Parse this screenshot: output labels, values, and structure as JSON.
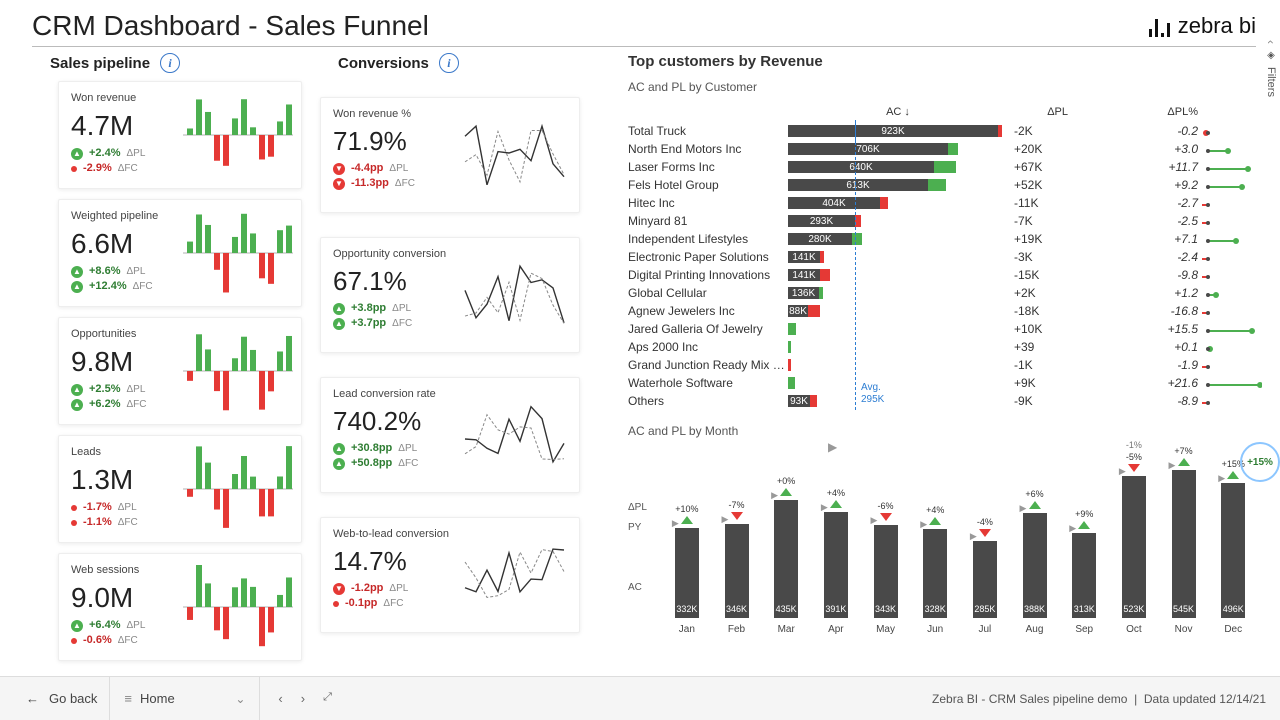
{
  "title": "CRM Dashboard - Sales Funnel",
  "brand": "zebra bi",
  "filters_label": "Filters",
  "sections": {
    "pipeline": "Sales pipeline",
    "conversions": "Conversions",
    "top_customers": "Top customers by Revenue",
    "by_customer_sub": "AC and PL by Customer",
    "by_month_sub": "AC and PL by Month"
  },
  "pipeline_cards": [
    {
      "title": "Won revenue",
      "value": "4.7M",
      "d1": "+2.4%",
      "d1s": "pos",
      "d2": "-2.9%",
      "d2s": "neg",
      "d2icon": "dot"
    },
    {
      "title": "Weighted pipeline",
      "value": "6.6M",
      "d1": "+8.6%",
      "d1s": "pos",
      "d2": "+12.4%",
      "d2s": "pos"
    },
    {
      "title": "Opportunities",
      "value": "9.8M",
      "d1": "+2.5%",
      "d1s": "pos",
      "d2": "+6.2%",
      "d2s": "pos"
    },
    {
      "title": "Leads",
      "value": "1.3M",
      "d1": "-1.7%",
      "d1s": "neg",
      "d1icon": "dot",
      "d2": "-1.1%",
      "d2s": "neg",
      "d2icon": "dot"
    },
    {
      "title": "Web sessions",
      "value": "9.0M",
      "d1": "+6.4%",
      "d1s": "pos",
      "d2": "-0.6%",
      "d2s": "neg",
      "d2icon": "dot"
    }
  ],
  "conversion_cards": [
    {
      "title": "Won revenue %",
      "value": "71.9%",
      "d1": "-4.4pp",
      "d1s": "neg",
      "d2": "-11.3pp",
      "d2s": "neg"
    },
    {
      "title": "Opportunity conversion",
      "value": "67.1%",
      "d1": "+3.8pp",
      "d1s": "pos",
      "d2": "+3.7pp",
      "d2s": "pos"
    },
    {
      "title": "Lead conversion rate",
      "value": "740.2%",
      "d1": "+30.8pp",
      "d1s": "pos",
      "d2": "+50.8pp",
      "d2s": "pos"
    },
    {
      "title": "Web-to-lead conversion",
      "value": "14.7%",
      "d1": "-1.2pp",
      "d1s": "neg",
      "d2": "-0.1pp",
      "d2s": "neg",
      "d2icon": "dot"
    }
  ],
  "delta_labels": {
    "pl": "ΔPL",
    "fc": "ΔFC"
  },
  "table_headers": {
    "ac": "AC ↓",
    "dpl": "ΔPL",
    "dplp": "ΔPL%"
  },
  "avg_label": "Avg.",
  "avg_value": "295K",
  "customers": [
    {
      "name": "Total Truck",
      "ac": "923K",
      "acw": 210,
      "dpl": "-2K",
      "caps": "r",
      "capw": 4,
      "dplp": "-0.2",
      "lolli": -2
    },
    {
      "name": "North End Motors Inc",
      "ac": "706K",
      "acw": 160,
      "dpl": "+20K",
      "caps": "g",
      "capw": 10,
      "dplp": "+3.0",
      "lolli": 20
    },
    {
      "name": "Laser Forms Inc",
      "ac": "640K",
      "acw": 146,
      "dpl": "+67K",
      "caps": "g",
      "capw": 22,
      "dplp": "+11.7",
      "lolli": 40
    },
    {
      "name": "Fels Hotel Group",
      "ac": "613K",
      "acw": 140,
      "dpl": "+52K",
      "caps": "g",
      "capw": 18,
      "dplp": "+9.2",
      "lolli": 34
    },
    {
      "name": "Hitec Inc",
      "ac": "404K",
      "acw": 92,
      "dpl": "-11K",
      "caps": "r",
      "capw": 8,
      "dplp": "-2.7",
      "lolli": -14
    },
    {
      "name": "Minyard 81",
      "ac": "293K",
      "acw": 67,
      "dpl": "-7K",
      "caps": "r",
      "capw": 6,
      "dplp": "-2.5",
      "lolli": -12
    },
    {
      "name": "Independent Lifestyles",
      "ac": "280K",
      "acw": 64,
      "dpl": "+19K",
      "caps": "g",
      "capw": 10,
      "dplp": "+7.1",
      "lolli": 28
    },
    {
      "name": "Electronic Paper Solutions",
      "ac": "141K",
      "acw": 32,
      "dpl": "-3K",
      "caps": "r",
      "capw": 4,
      "dplp": "-2.4",
      "lolli": -12
    },
    {
      "name": "Digital Printing Innovations",
      "ac": "141K",
      "acw": 32,
      "dpl": "-15K",
      "caps": "r",
      "capw": 10,
      "dplp": "-9.8",
      "lolli": -32
    },
    {
      "name": "Global Cellular",
      "ac": "136K",
      "acw": 31,
      "dpl": "+2K",
      "caps": "g",
      "capw": 4,
      "dplp": "+1.2",
      "lolli": 8
    },
    {
      "name": "Agnew Jewelers Inc",
      "ac": "88K",
      "acw": 20,
      "dpl": "-18K",
      "caps": "r",
      "capw": 12,
      "dplp": "-16.8",
      "lolli": -48
    },
    {
      "name": "Jared Galleria Of Jewelry",
      "ac": "",
      "acw": 0,
      "dpl": "+10K",
      "caps": "g",
      "capw": 8,
      "dplp": "+15.5",
      "lolli": 44
    },
    {
      "name": "Aps 2000 Inc",
      "ac": "",
      "acw": 0,
      "dpl": "+39",
      "caps": "g",
      "capw": 3,
      "dplp": "+0.1",
      "lolli": 2
    },
    {
      "name": "Grand Junction Ready Mix C...",
      "ac": "",
      "acw": 0,
      "dpl": "-1K",
      "caps": "r",
      "capw": 3,
      "dplp": "-1.9",
      "lolli": -10
    },
    {
      "name": "Waterhole Software",
      "ac": "",
      "acw": 0,
      "dpl": "+9K",
      "caps": "g",
      "capw": 7,
      "dplp": "+21.6",
      "lolli": 52
    },
    {
      "name": "Others",
      "ac": "93K",
      "acw": 22,
      "dpl": "-9K",
      "caps": "r",
      "capw": 7,
      "dplp": "-8.9",
      "lolli": -30
    }
  ],
  "months": [
    {
      "m": "Jan",
      "v": "332K",
      "h": 90,
      "top": "+10%",
      "dir": "up"
    },
    {
      "m": "Feb",
      "v": "346K",
      "h": 94,
      "top": "-7%",
      "dir": "dn"
    },
    {
      "m": "Mar",
      "v": "435K",
      "h": 118,
      "top": "+0%",
      "dir": "up"
    },
    {
      "m": "Apr",
      "v": "391K",
      "h": 106,
      "top": "+4%",
      "dir": "up"
    },
    {
      "m": "May",
      "v": "343K",
      "h": 93,
      "top": "-6%",
      "dir": "dn"
    },
    {
      "m": "Jun",
      "v": "328K",
      "h": 89,
      "top": "+4%",
      "dir": "up"
    },
    {
      "m": "Jul",
      "v": "285K",
      "h": 77,
      "top": "-4%",
      "dir": "dn"
    },
    {
      "m": "Aug",
      "v": "388K",
      "h": 105,
      "top": "+6%",
      "dir": "up"
    },
    {
      "m": "Sep",
      "v": "313K",
      "h": 85,
      "top": "+9%",
      "dir": "up"
    },
    {
      "m": "Oct",
      "v": "523K",
      "h": 142,
      "top": "-5%",
      "dir": "dn",
      "pre": "-1%"
    },
    {
      "m": "Nov",
      "v": "545K",
      "h": 148,
      "top": "+7%",
      "dir": "up"
    },
    {
      "m": "Dec",
      "v": "496K",
      "h": 135,
      "top": "+15%",
      "dir": "up"
    }
  ],
  "month_highlight": "+15%",
  "month_axis": {
    "dpl": "ΔPL",
    "py": "PY",
    "ac": "AC"
  },
  "footer": {
    "back": "Go back",
    "home": "Home",
    "meta_left": "Zebra BI - CRM Sales pipeline demo",
    "meta_right": "Data updated 12/14/21"
  },
  "chart_data": {
    "pipeline_kpis": [
      {
        "metric": "Won revenue",
        "value": 4700000,
        "delta_pl_pct": 2.4,
        "delta_fc_pct": -2.9
      },
      {
        "metric": "Weighted pipeline",
        "value": 6600000,
        "delta_pl_pct": 8.6,
        "delta_fc_pct": 12.4
      },
      {
        "metric": "Opportunities",
        "value": 9800000,
        "delta_pl_pct": 2.5,
        "delta_fc_pct": 6.2
      },
      {
        "metric": "Leads",
        "value": 1300000,
        "delta_pl_pct": -1.7,
        "delta_fc_pct": -1.1
      },
      {
        "metric": "Web sessions",
        "value": 9000000,
        "delta_pl_pct": 6.4,
        "delta_fc_pct": -0.6
      }
    ],
    "conversion_rates": [
      {
        "metric": "Won revenue %",
        "value_pct": 71.9,
        "delta_pl_pp": -4.4,
        "delta_fc_pp": -11.3
      },
      {
        "metric": "Opportunity conversion",
        "value_pct": 67.1,
        "delta_pl_pp": 3.8,
        "delta_fc_pp": 3.7
      },
      {
        "metric": "Lead conversion rate",
        "value_pct": 740.2,
        "delta_pl_pp": 30.8,
        "delta_fc_pp": 50.8
      },
      {
        "metric": "Web-to-lead conversion",
        "value_pct": 14.7,
        "delta_pl_pp": -1.2,
        "delta_fc_pp": -0.1
      }
    ],
    "top_customers": {
      "type": "bar",
      "title": "AC and PL by Customer",
      "xlabel": "AC",
      "ylabel": "Customer",
      "average": 295000,
      "series": [
        {
          "name": "AC",
          "unit": "K",
          "values": [
            923,
            706,
            640,
            613,
            404,
            293,
            280,
            141,
            141,
            136,
            88,
            null,
            null,
            null,
            null,
            93
          ]
        },
        {
          "name": "ΔPL",
          "unit": "K",
          "values": [
            -2,
            20,
            67,
            52,
            -11,
            -7,
            19,
            -3,
            -15,
            2,
            -18,
            10,
            0.039,
            -1,
            9,
            -9
          ]
        },
        {
          "name": "ΔPL%",
          "unit": "%",
          "values": [
            -0.2,
            3.0,
            11.7,
            9.2,
            -2.7,
            -2.5,
            7.1,
            -2.4,
            -9.8,
            1.2,
            -16.8,
            15.5,
            0.1,
            -1.9,
            21.6,
            -8.9
          ]
        }
      ],
      "categories": [
        "Total Truck",
        "North End Motors Inc",
        "Laser Forms Inc",
        "Fels Hotel Group",
        "Hitec Inc",
        "Minyard 81",
        "Independent Lifestyles",
        "Electronic Paper Solutions",
        "Digital Printing Innovations",
        "Global Cellular",
        "Agnew Jewelers Inc",
        "Jared Galleria Of Jewelry",
        "Aps 2000 Inc",
        "Grand Junction Ready Mix C...",
        "Waterhole Software",
        "Others"
      ]
    },
    "by_month": {
      "type": "bar",
      "title": "AC and PL by Month",
      "categories": [
        "Jan",
        "Feb",
        "Mar",
        "Apr",
        "May",
        "Jun",
        "Jul",
        "Aug",
        "Sep",
        "Oct",
        "Nov",
        "Dec"
      ],
      "series": [
        {
          "name": "AC",
          "unit": "K",
          "values": [
            332,
            346,
            435,
            391,
            343,
            328,
            285,
            388,
            313,
            523,
            545,
            496
          ]
        },
        {
          "name": "ΔPL%",
          "unit": "%",
          "values": [
            10,
            -7,
            0,
            4,
            -6,
            4,
            -4,
            6,
            9,
            -5,
            7,
            15
          ]
        }
      ],
      "ylim": [
        0,
        600
      ]
    }
  }
}
